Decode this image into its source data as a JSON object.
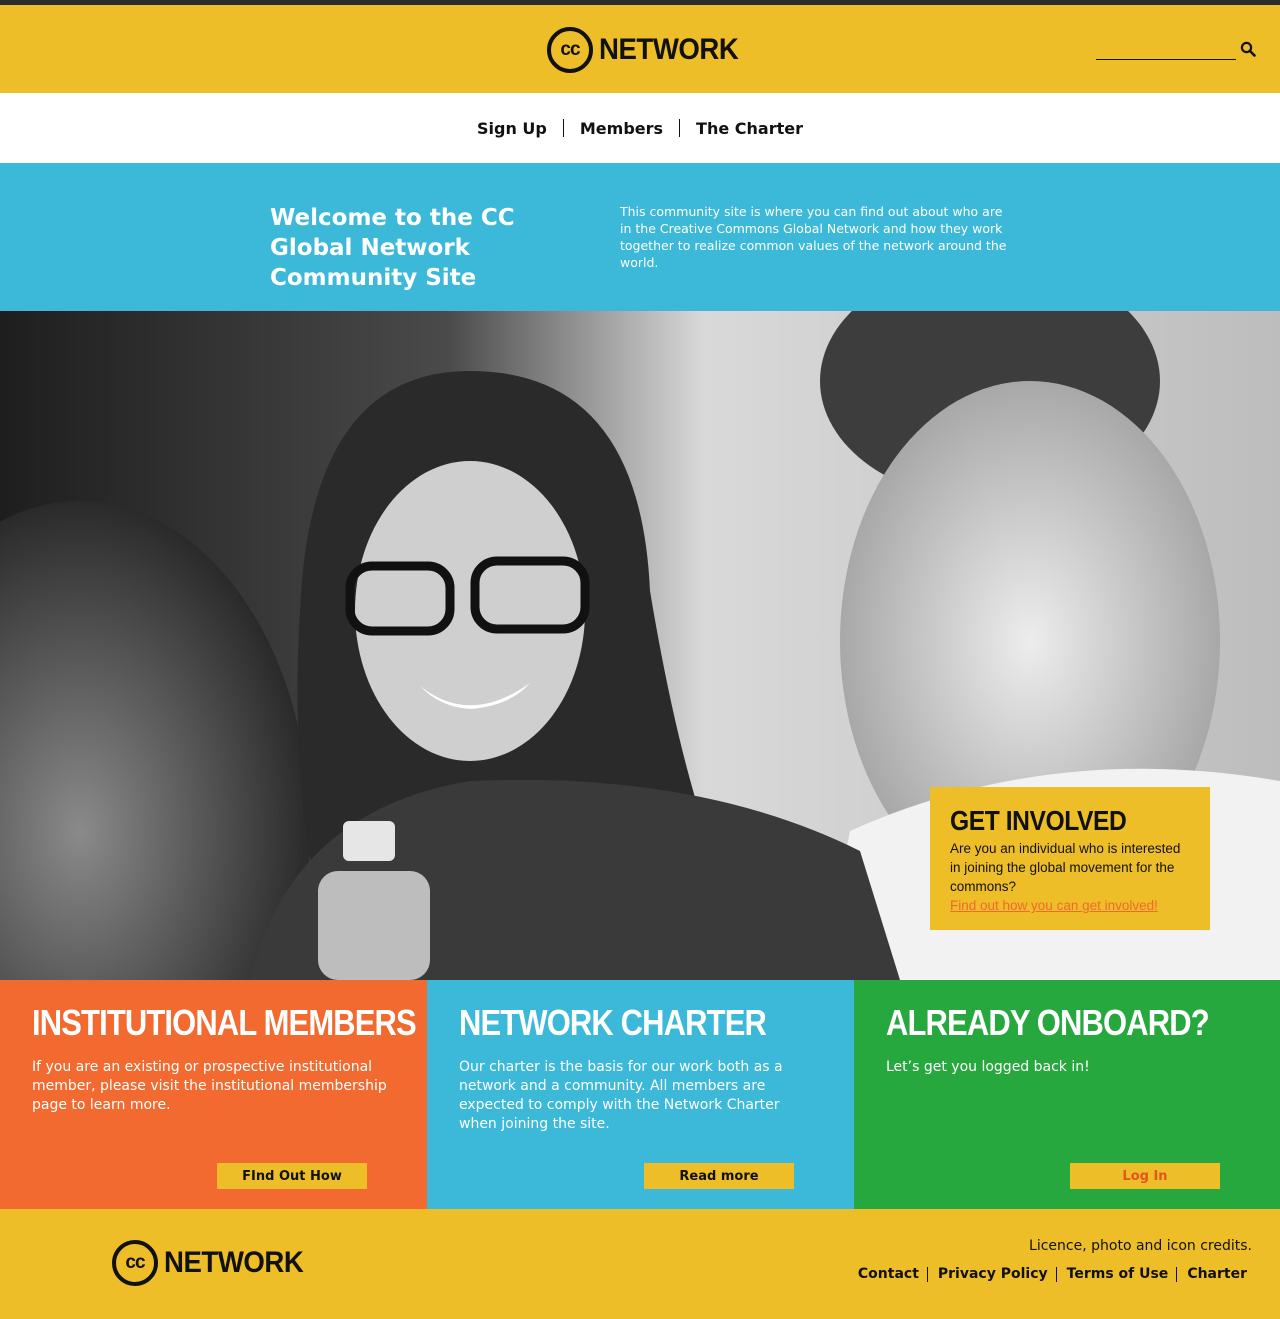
{
  "header": {
    "logo_mark": "cc",
    "logo_text": "NETWORK",
    "search_placeholder": "",
    "search_icon": "search-icon"
  },
  "nav": {
    "items": [
      {
        "label": "Sign Up"
      },
      {
        "label": "Members"
      },
      {
        "label": "The Charter"
      }
    ]
  },
  "welcome": {
    "title": "Welcome to the CC Global Network Community Site",
    "text": "This community site is where you can find out about who are in the Creative Commons Global Network and how they work together to realize common values of the network around the world."
  },
  "get_involved": {
    "title": "GET INVOLVED",
    "text": "Are you an individual who is interested in joining the global movement for the commons?",
    "link": "Find out how you can get involved!"
  },
  "cards": [
    {
      "title": "INSTITUTIONAL MEMBERS",
      "text": "If you are an existing or prospective institutional member, please visit the institutional membership page to learn more.",
      "button": "FInd Out How",
      "color": "#f26a30"
    },
    {
      "title": "NETWORK CHARTER",
      "text": "Our charter is the basis for our work both as a network and a community. All members are expected to comply with the Network Charter when joining the site.",
      "button": "Read more",
      "color": "#3cb9d8"
    },
    {
      "title": "ALREADY ONBOARD?",
      "text": "Let’s get you logged back in!",
      "button": "Log In",
      "color": "#27a83f"
    }
  ],
  "footer": {
    "logo_mark": "cc",
    "logo_text": "NETWORK",
    "credits": "Licence, photo and icon credits.",
    "links": [
      {
        "label": "Contact"
      },
      {
        "label": "Privacy Policy"
      },
      {
        "label": "Terms of Use"
      },
      {
        "label": "Charter"
      }
    ]
  },
  "colors": {
    "accent_yellow": "#eebe28",
    "accent_blue": "#3cb9d8",
    "accent_orange": "#f26a30",
    "accent_green": "#27a83f",
    "topbar": "#2b2b2b"
  }
}
